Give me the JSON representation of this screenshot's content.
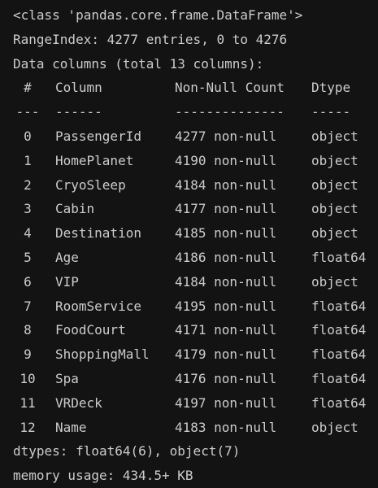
{
  "header": {
    "class_line": "<class 'pandas.core.frame.DataFrame'>",
    "range_index": "RangeIndex: 4277 entries, 0 to 4276",
    "data_columns": "Data columns (total 13 columns):"
  },
  "table": {
    "headers": {
      "num": "#",
      "column": "Column",
      "non_null": "Non-Null Count",
      "dtype": "Dtype"
    },
    "separators": {
      "num": "---",
      "column": "------",
      "non_null": "--------------",
      "dtype": "-----"
    },
    "rows": [
      {
        "num": "0",
        "column": "PassengerId",
        "non_null": "4277 non-null",
        "dtype": "object"
      },
      {
        "num": "1",
        "column": "HomePlanet",
        "non_null": "4190 non-null",
        "dtype": "object"
      },
      {
        "num": "2",
        "column": "CryoSleep",
        "non_null": "4184 non-null",
        "dtype": "object"
      },
      {
        "num": "3",
        "column": "Cabin",
        "non_null": "4177 non-null",
        "dtype": "object"
      },
      {
        "num": "4",
        "column": "Destination",
        "non_null": "4185 non-null",
        "dtype": "object"
      },
      {
        "num": "5",
        "column": "Age",
        "non_null": "4186 non-null",
        "dtype": "float64"
      },
      {
        "num": "6",
        "column": "VIP",
        "non_null": "4184 non-null",
        "dtype": "object"
      },
      {
        "num": "7",
        "column": "RoomService",
        "non_null": "4195 non-null",
        "dtype": "float64"
      },
      {
        "num": "8",
        "column": "FoodCourt",
        "non_null": "4171 non-null",
        "dtype": "float64"
      },
      {
        "num": "9",
        "column": "ShoppingMall",
        "non_null": "4179 non-null",
        "dtype": "float64"
      },
      {
        "num": "10",
        "column": "Spa",
        "non_null": "4176 non-null",
        "dtype": "float64"
      },
      {
        "num": "11",
        "column": "VRDeck",
        "non_null": "4197 non-null",
        "dtype": "float64"
      },
      {
        "num": "12",
        "column": "Name",
        "non_null": "4183 non-null",
        "dtype": "object"
      }
    ]
  },
  "footer": {
    "dtypes": "dtypes: float64(6), object(7)",
    "memory": "memory usage: 434.5+ KB"
  },
  "colors": {
    "background": "#131313",
    "text": "#cccccc"
  }
}
